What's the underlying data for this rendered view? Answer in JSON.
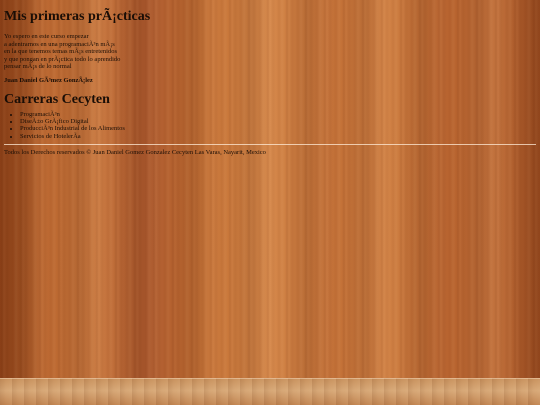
{
  "page": {
    "title": "Mis primeras prÃ¡cticas",
    "intro_lines": [
      "Yo espero en este curso empezar",
      "a adentrarnos en una programaciÃ³n mÃ¡s",
      "en la que tenemos temas mÃ¡s entretenidos",
      "y que pongan en prÃ¡ctica todo lo aprendido",
      "pensar mÃ¡s de lo normal"
    ],
    "author": "Juan Daniel GÃ³mez GonzÃ¡lez",
    "careers_heading": "Carreras Cecyten",
    "careers": [
      "ProgramaciÃ³n",
      "DiseÃ±o GrÃ¡fico Digital",
      "ProducciÃ³n Industrial de los Alimentos",
      "Servicios de HotelerÃ­a"
    ],
    "footer": "Todos los Derechos reservados © Juan Daniel Gomez Gonzalez Cecyten Las Varas, Nayarit, Mexico"
  },
  "colors": {
    "text": "#1a0e06",
    "background_wood": "#b5622b",
    "divider": "#ffebd7"
  }
}
